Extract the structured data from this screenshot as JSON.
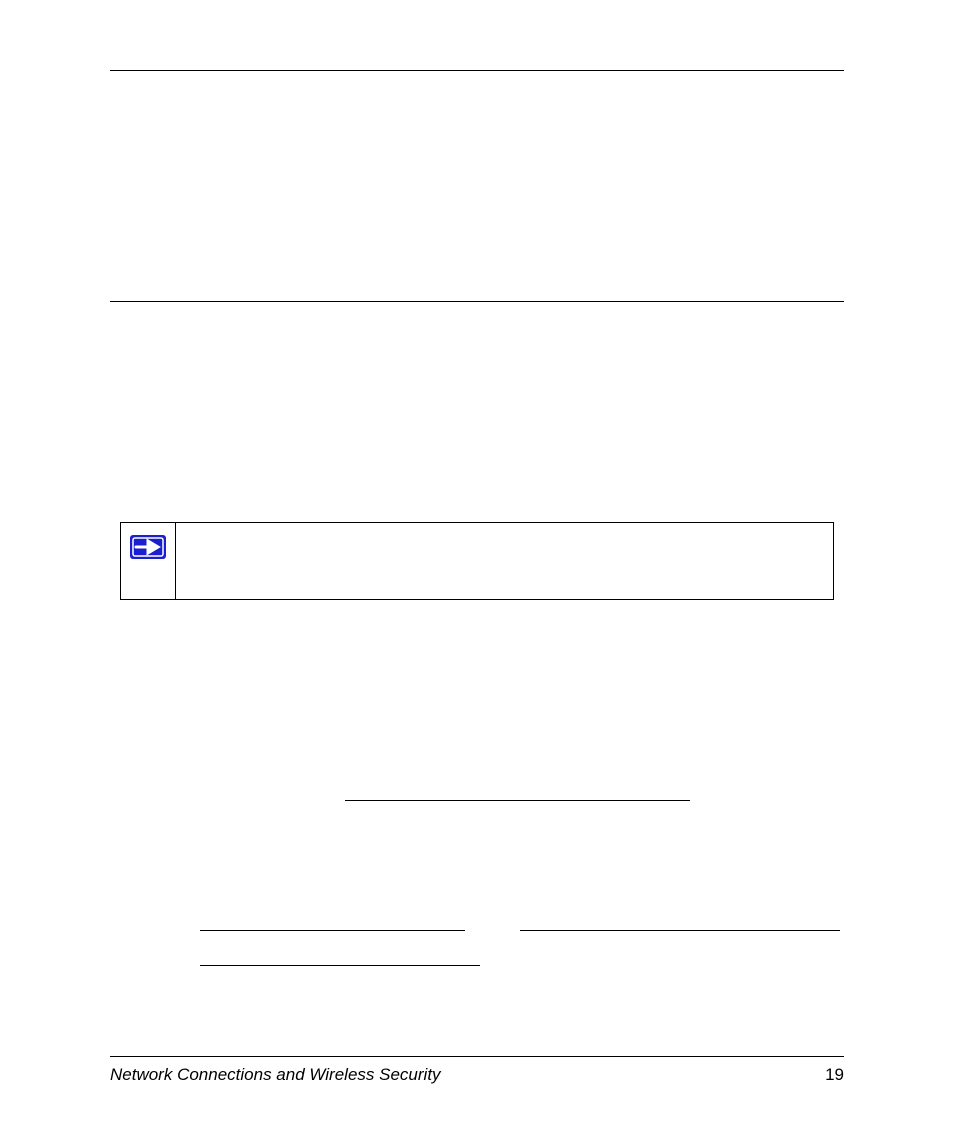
{
  "footer": {
    "section_title": "Network Connections and Wireless Security",
    "page_number": "19"
  },
  "note": {
    "icon": "arrow-right-icon"
  }
}
